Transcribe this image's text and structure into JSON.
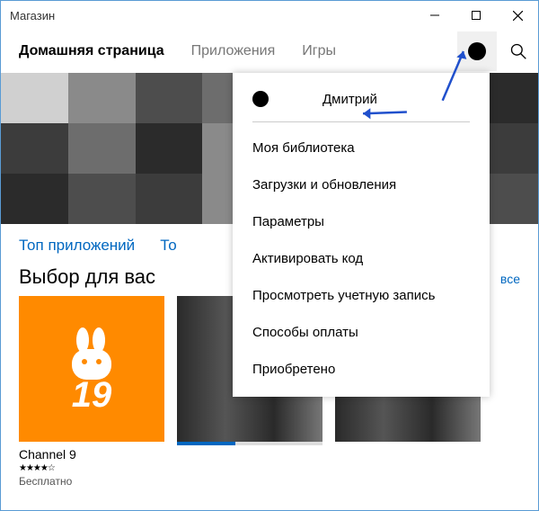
{
  "window": {
    "title": "Магазин"
  },
  "nav": {
    "tabs": [
      {
        "label": "Домашняя страница",
        "active": true
      },
      {
        "label": "Приложения",
        "active": false
      },
      {
        "label": "Игры",
        "active": false
      }
    ]
  },
  "menu": {
    "user_name": "Дмитрий",
    "items": [
      "Моя библиотека",
      "Загрузки и обновления",
      "Параметры",
      "Активировать код",
      "Просмотреть учетную запись",
      "Способы оплаты",
      "Приобретено"
    ]
  },
  "categories": {
    "items": [
      "Топ приложений",
      "То"
    ]
  },
  "section": {
    "title": "Выбор для вас",
    "all_link": "все"
  },
  "card1": {
    "name": "Channel 9",
    "stars": "★★★★☆",
    "price": "Бесплатно"
  },
  "colors": {
    "accent": "#0067c0",
    "tile_orange": "#ff8a00"
  }
}
